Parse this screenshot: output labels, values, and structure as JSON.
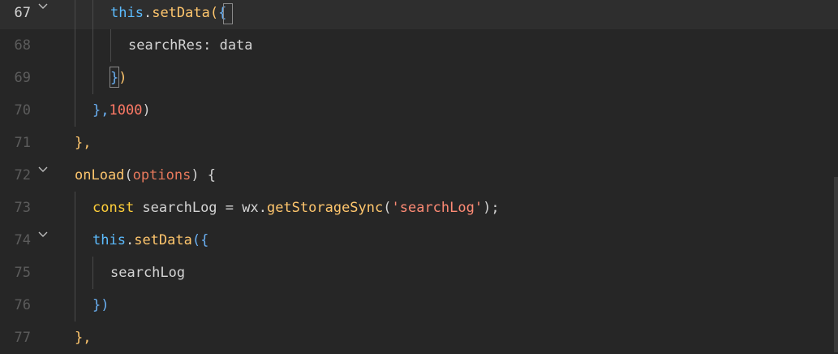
{
  "editor": {
    "lines": [
      {
        "number": "67",
        "current": true,
        "foldable": true
      },
      {
        "number": "68",
        "current": false,
        "foldable": false
      },
      {
        "number": "69",
        "current": false,
        "foldable": false
      },
      {
        "number": "70",
        "current": false,
        "foldable": false
      },
      {
        "number": "71",
        "current": false,
        "foldable": false
      },
      {
        "number": "72",
        "current": false,
        "foldable": true
      },
      {
        "number": "73",
        "current": false,
        "foldable": false
      },
      {
        "number": "74",
        "current": false,
        "foldable": true
      },
      {
        "number": "75",
        "current": false,
        "foldable": false
      },
      {
        "number": "76",
        "current": false,
        "foldable": false
      },
      {
        "number": "77",
        "current": false,
        "foldable": false
      }
    ],
    "code": {
      "l67": {
        "this": "this",
        "dot": ".",
        "method": "setData",
        "paren": "(",
        "brace": "{"
      },
      "l68": {
        "text": "searchRes: data"
      },
      "l69": {
        "brace": "}",
        "paren": ")"
      },
      "l70": {
        "close": "},",
        "num": "1000",
        "paren": ")"
      },
      "l71": {
        "text": "},"
      },
      "l72": {
        "name": "onLoad",
        "open": "(",
        "param": "options",
        "rest": ") {"
      },
      "l73": {
        "kw": "const",
        "mid": " searchLog = wx.",
        "method": "getStorageSync",
        "open": "(",
        "str": "'searchLog'",
        "close": ");"
      },
      "l74": {
        "this": "this",
        "dot": ".",
        "method": "setData",
        "open": "({"
      },
      "l75": {
        "text": "searchLog"
      },
      "l76": {
        "text": "})"
      },
      "l77": {
        "text": "},"
      }
    },
    "fold_icon": "chevron-down-icon"
  }
}
